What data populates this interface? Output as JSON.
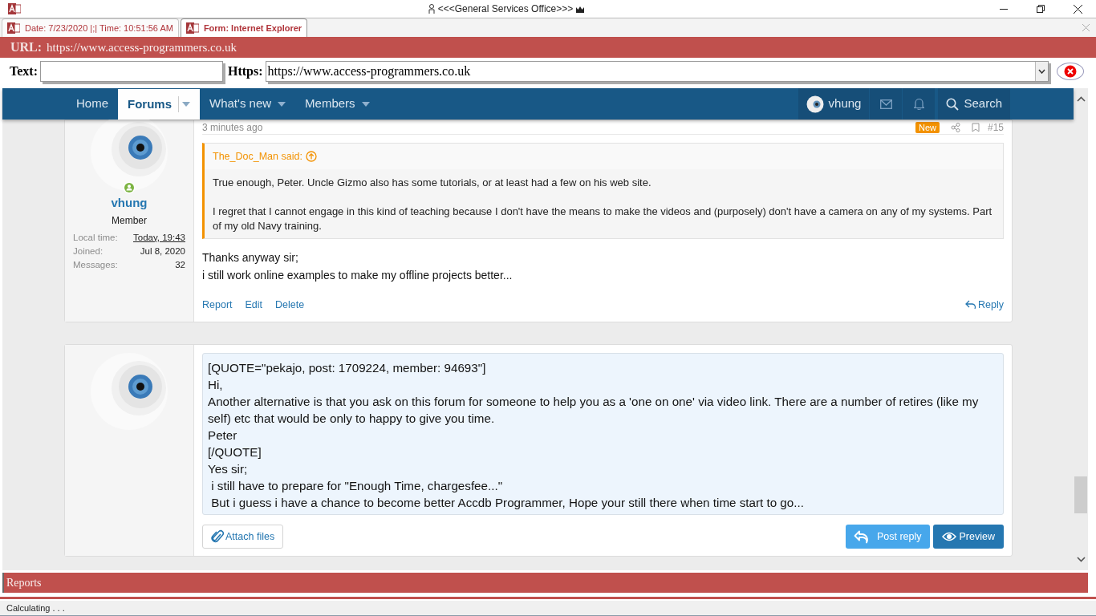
{
  "window": {
    "title": "<<<General Services Office>>>"
  },
  "tabs": [
    {
      "label": "Date: 7/23/2020 |;| Time: 10:51:56 AM",
      "selected": false
    },
    {
      "label": "Form: Internet Explorer",
      "selected": true
    }
  ],
  "url_bar": {
    "label": "URL:",
    "value": "https://www.access-programmers.co.uk"
  },
  "text_field": {
    "label": "Text:"
  },
  "https_field": {
    "label": "Https:",
    "value": "https://www.access-programmers.co.uk"
  },
  "nav": {
    "items": [
      {
        "label": "Home",
        "selected": false,
        "dropdown": false
      },
      {
        "label": "Forums",
        "selected": true,
        "dropdown": true
      },
      {
        "label": "What's new",
        "selected": false,
        "dropdown": true
      },
      {
        "label": "Members",
        "selected": false,
        "dropdown": true
      }
    ],
    "user": "vhung",
    "search": "Search"
  },
  "post": {
    "time": "3 minutes ago",
    "badge": "New",
    "number": "#15",
    "author": "vhung",
    "online": true,
    "role": "Member",
    "stats": [
      {
        "label": "Local time:",
        "value": "Today, 19:43",
        "kind": "link"
      },
      {
        "label": "Joined:",
        "value": "Jul 8, 2020",
        "kind": "text"
      },
      {
        "label": "Messages:",
        "value": "32",
        "kind": "text"
      }
    ],
    "quote": {
      "author": "The_Doc_Man said:",
      "paragraphs": [
        "True enough, Peter. Uncle Gizmo also has some tutorials, or at least had a few on his web site.",
        "I regret that I cannot engage in this kind of teaching because I don't have the means to make the videos and (purposely) don't have a camera on any of my systems. Part of my old Navy training."
      ]
    },
    "body": [
      "Thanks anyway sir;",
      "i still work online examples to make my offline projects better..."
    ],
    "actions": [
      "Report",
      "Edit",
      "Delete"
    ],
    "reply": "Reply"
  },
  "reply_form": {
    "lines": [
      "[QUOTE=\"pekajo, post: 1709224, member: 94693\"]",
      "Hi,",
      "Another alternative is that you ask on this forum for someone to help you as a 'one on one' via video link. There are a number of retires (like my self) etc that would be only to happy to give you time.",
      "Peter",
      "[/QUOTE]",
      "Yes sir;",
      " i still have to prepare for \"Enough Time, chargesfee...\"",
      " But i guess i have a chance to become better Accdb Programmer, Hope your still there when time start to go..."
    ],
    "attach": "Attach files",
    "buttons": [
      {
        "label": "Post reply",
        "kind": "secondary"
      },
      {
        "label": "Preview",
        "kind": "primary"
      }
    ]
  },
  "reports": "Reports",
  "status": "Calculating . . ."
}
